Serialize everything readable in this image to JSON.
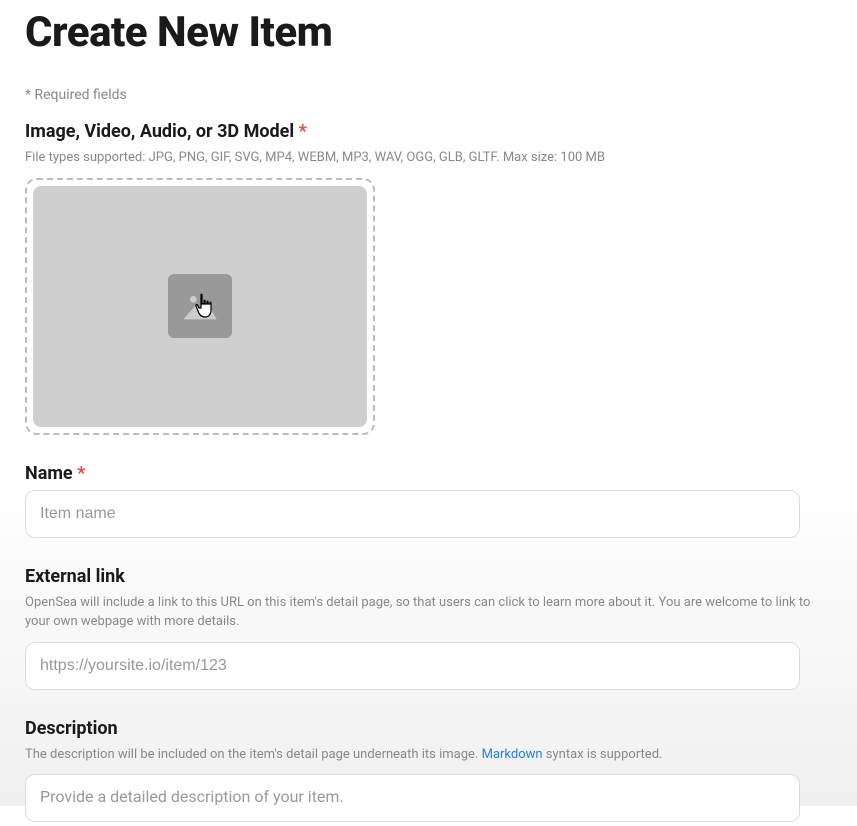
{
  "page_title": "Create New Item",
  "required_note": "* Required fields",
  "media": {
    "label": "Image, Video, Audio, or 3D Model",
    "required_star": "*",
    "hint": "File types supported: JPG, PNG, GIF, SVG, MP4, WEBM, MP3, WAV, OGG, GLB, GLTF. Max size: 100 MB"
  },
  "name": {
    "label": "Name",
    "required_star": "*",
    "placeholder": "Item name",
    "value": ""
  },
  "external_link": {
    "label": "External link",
    "hint": "OpenSea will include a link to this URL on this item's detail page, so that users can click to learn more about it. You are welcome to link to your own webpage with more details.",
    "placeholder": "https://yoursite.io/item/123",
    "value": ""
  },
  "description": {
    "label": "Description",
    "hint_prefix": "The description will be included on the item's detail page underneath its image. ",
    "hint_link": "Markdown",
    "hint_suffix": " syntax is supported.",
    "placeholder": "Provide a detailed description of your item.",
    "value": ""
  }
}
